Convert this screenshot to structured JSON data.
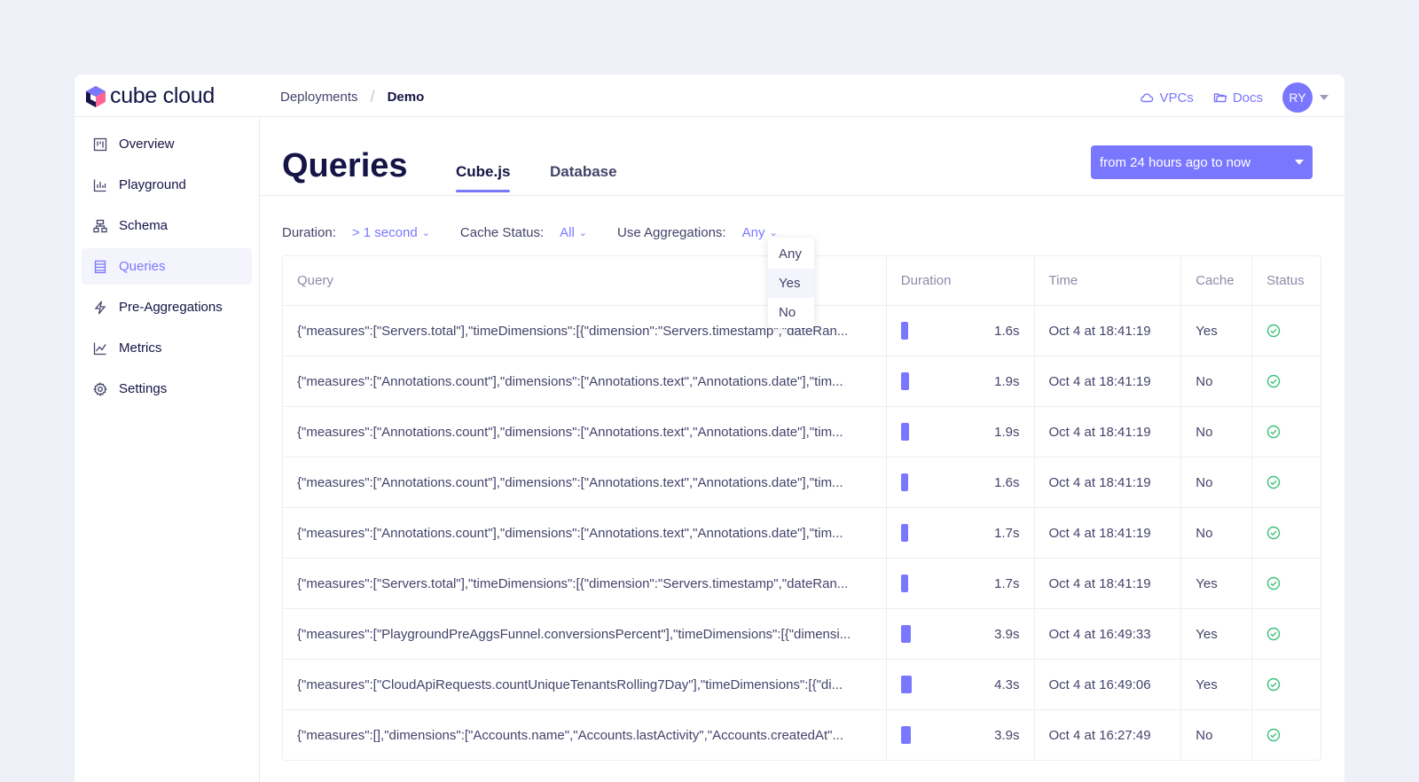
{
  "brand": {
    "name": "cube cloud"
  },
  "breadcrumb": {
    "parent": "Deployments",
    "current": "Demo"
  },
  "header": {
    "vpcs_label": "VPCs",
    "docs_label": "Docs",
    "avatar_initials": "RY"
  },
  "sidebar": {
    "items": [
      {
        "label": "Overview",
        "icon": "overview-icon"
      },
      {
        "label": "Playground",
        "icon": "bar-chart-icon"
      },
      {
        "label": "Schema",
        "icon": "schema-icon"
      },
      {
        "label": "Queries",
        "icon": "queries-icon",
        "active": true
      },
      {
        "label": "Pre-Aggregations",
        "icon": "lightning-icon"
      },
      {
        "label": "Metrics",
        "icon": "line-chart-icon"
      },
      {
        "label": "Settings",
        "icon": "gear-icon"
      }
    ]
  },
  "page": {
    "title": "Queries",
    "tabs": [
      {
        "label": "Cube.js",
        "active": true
      },
      {
        "label": "Database"
      }
    ],
    "date_range": "from 24 hours ago to now"
  },
  "filters": {
    "duration_label": "Duration:",
    "duration_value": "> 1 second",
    "cache_label": "Cache Status:",
    "cache_value": "All",
    "agg_label": "Use Aggregations:",
    "agg_value": "Any"
  },
  "agg_menu": {
    "options": [
      "Any",
      "Yes",
      "No"
    ],
    "hovered": "Yes"
  },
  "table": {
    "columns": [
      "Query",
      "Duration",
      "Time",
      "Cache",
      "Status"
    ],
    "rows": [
      {
        "query": "{\"measures\":[\"Servers.total\"],\"timeDimensions\":[{\"dimension\":\"Servers.timestamp\",\"dateRan...",
        "duration": "1.6s",
        "time": "Oct 4 at 18:41:19",
        "cache": "Yes",
        "status": "success"
      },
      {
        "query": "{\"measures\":[\"Annotations.count\"],\"dimensions\":[\"Annotations.text\",\"Annotations.date\"],\"tim...",
        "duration": "1.9s",
        "time": "Oct 4 at 18:41:19",
        "cache": "No",
        "status": "success"
      },
      {
        "query": "{\"measures\":[\"Annotations.count\"],\"dimensions\":[\"Annotations.text\",\"Annotations.date\"],\"tim...",
        "duration": "1.9s",
        "time": "Oct 4 at 18:41:19",
        "cache": "No",
        "status": "success"
      },
      {
        "query": "{\"measures\":[\"Annotations.count\"],\"dimensions\":[\"Annotations.text\",\"Annotations.date\"],\"tim...",
        "duration": "1.6s",
        "time": "Oct 4 at 18:41:19",
        "cache": "No",
        "status": "success"
      },
      {
        "query": "{\"measures\":[\"Annotations.count\"],\"dimensions\":[\"Annotations.text\",\"Annotations.date\"],\"tim...",
        "duration": "1.7s",
        "time": "Oct 4 at 18:41:19",
        "cache": "No",
        "status": "success"
      },
      {
        "query": "{\"measures\":[\"Servers.total\"],\"timeDimensions\":[{\"dimension\":\"Servers.timestamp\",\"dateRan...",
        "duration": "1.7s",
        "time": "Oct 4 at 18:41:19",
        "cache": "Yes",
        "status": "success"
      },
      {
        "query": "{\"measures\":[\"PlaygroundPreAggsFunnel.conversionsPercent\"],\"timeDimensions\":[{\"dimensi...",
        "duration": "3.9s",
        "time": "Oct 4 at 16:49:33",
        "cache": "Yes",
        "status": "success"
      },
      {
        "query": "{\"measures\":[\"CloudApiRequests.countUniqueTenantsRolling7Day\"],\"timeDimensions\":[{\"di...",
        "duration": "4.3s",
        "time": "Oct 4 at 16:49:06",
        "cache": "Yes",
        "status": "success"
      },
      {
        "query": "{\"measures\":[],\"dimensions\":[\"Accounts.name\",\"Accounts.lastActivity\",\"Accounts.createdAt\"...",
        "duration": "3.9s",
        "time": "Oct 4 at 16:27:49",
        "cache": "No",
        "status": "success"
      }
    ]
  },
  "colors": {
    "accent": "#7a77ff",
    "text": "#141446",
    "muted": "#43436b",
    "success": "#3cc07a",
    "background": "#eff1f9"
  }
}
